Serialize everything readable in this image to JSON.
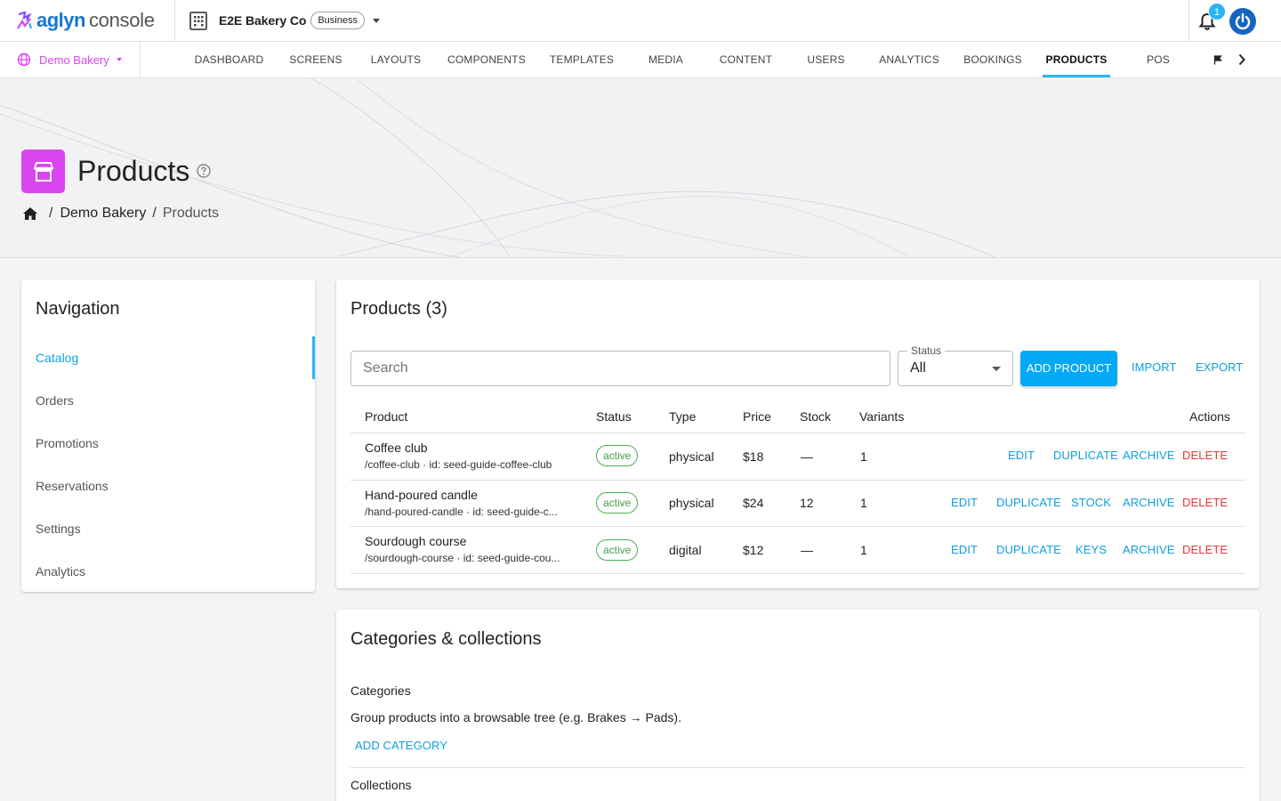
{
  "app": {
    "logo_part1": "aglyn",
    "logo_part2": "console"
  },
  "org": {
    "name": "E2E Bakery Co",
    "plan": "Business"
  },
  "notifications": {
    "count": "1"
  },
  "site": {
    "name": "Demo Bakery"
  },
  "tabs": [
    {
      "label": "DASHBOARD"
    },
    {
      "label": "SCREENS"
    },
    {
      "label": "LAYOUTS"
    },
    {
      "label": "COMPONENTS"
    },
    {
      "label": "TEMPLATES"
    },
    {
      "label": "MEDIA"
    },
    {
      "label": "CONTENT"
    },
    {
      "label": "USERS"
    },
    {
      "label": "ANALYTICS"
    },
    {
      "label": "BOOKINGS"
    },
    {
      "label": "PRODUCTS",
      "active": true
    },
    {
      "label": "POS"
    }
  ],
  "page": {
    "title": "Products"
  },
  "breadcrumb": {
    "site": "Demo Bakery",
    "current": "Products"
  },
  "sidebar": {
    "title": "Navigation",
    "items": [
      {
        "label": "Catalog",
        "active": true
      },
      {
        "label": "Orders"
      },
      {
        "label": "Promotions"
      },
      {
        "label": "Reservations"
      },
      {
        "label": "Settings"
      },
      {
        "label": "Analytics"
      }
    ]
  },
  "products": {
    "title": "Products (3)",
    "search_placeholder": "Search",
    "status_label": "Status",
    "status_value": "All",
    "add_label": "ADD PRODUCT",
    "import_label": "IMPORT",
    "export_label": "EXPORT",
    "columns": {
      "product": "Product",
      "status": "Status",
      "type": "Type",
      "price": "Price",
      "stock": "Stock",
      "variants": "Variants",
      "actions": "Actions"
    },
    "rows": [
      {
        "name": "Coffee club",
        "sub": "/coffee-club · id: seed-guide-coffee-club",
        "status": "active",
        "type": "physical",
        "price": "$18",
        "stock": "—",
        "variants": "1",
        "actions": [
          "EDIT",
          "DUPLICATE",
          "ARCHIVE",
          "DELETE"
        ]
      },
      {
        "name": "Hand-poured candle",
        "sub": "/hand-poured-candle · id: seed-guide-c...",
        "status": "active",
        "type": "physical",
        "price": "$24",
        "stock": "12",
        "variants": "1",
        "actions": [
          "EDIT",
          "DUPLICATE",
          "STOCK",
          "ARCHIVE",
          "DELETE"
        ]
      },
      {
        "name": "Sourdough course",
        "sub": "/sourdough-course · id: seed-guide-cou...",
        "status": "active",
        "type": "digital",
        "price": "$12",
        "stock": "—",
        "variants": "1",
        "actions": [
          "EDIT",
          "DUPLICATE",
          "KEYS",
          "ARCHIVE",
          "DELETE"
        ]
      }
    ]
  },
  "categories": {
    "title": "Categories & collections",
    "categories_heading": "Categories",
    "categories_desc": "Group products into a browsable tree (e.g. Brakes → Pads).",
    "add_category_label": "ADD CATEGORY",
    "collections_heading": "Collections"
  },
  "colors": {
    "accent": "#03a9f4",
    "brand": "#d946ef",
    "danger": "#e53935",
    "success": "#43a047"
  }
}
